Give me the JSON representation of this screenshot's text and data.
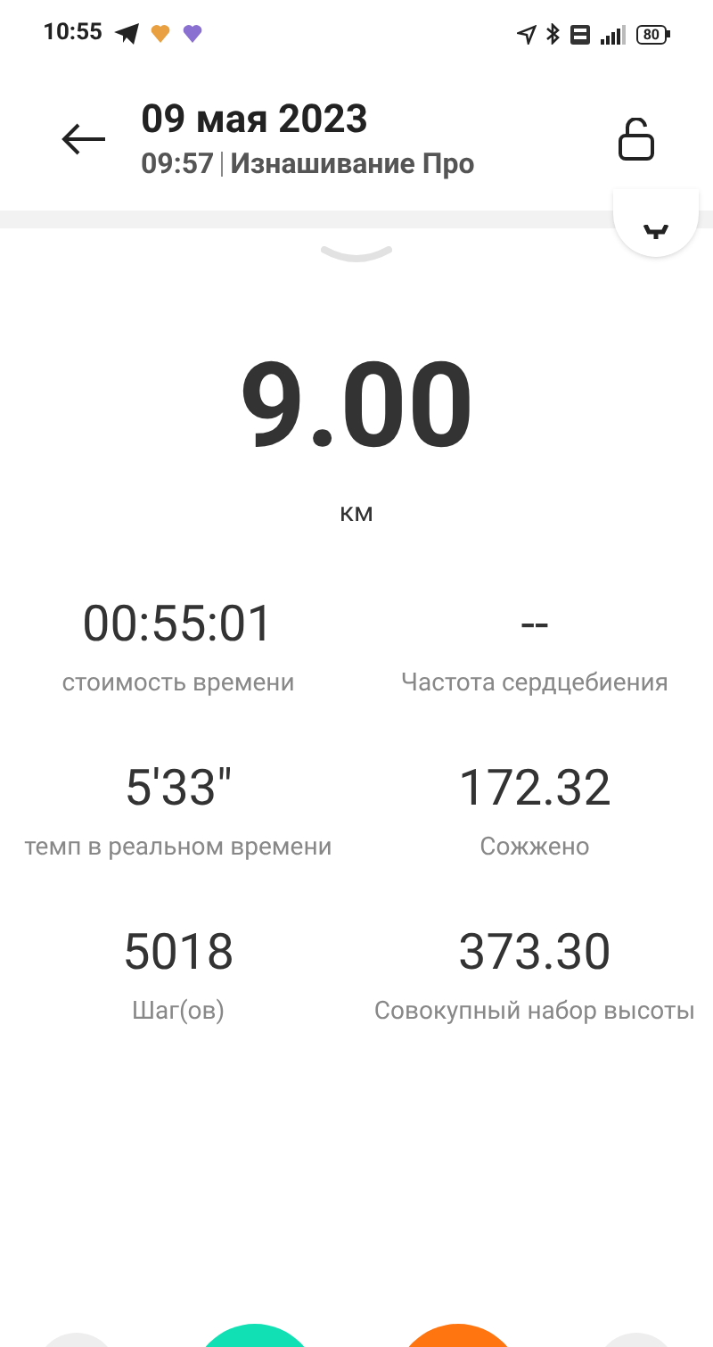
{
  "status_bar": {
    "time": "10:55",
    "battery": "80"
  },
  "header": {
    "title": "09 мая 2023",
    "time": "09:57",
    "device": "Изнашивание Про"
  },
  "distance": {
    "value": "9.00",
    "unit": "км"
  },
  "stats": [
    {
      "value": "00:55:01",
      "label": "стоимость времени"
    },
    {
      "value": "--",
      "label": "Частота сердцебиения"
    },
    {
      "value": "5'33\"",
      "label": "темп в реальном времени"
    },
    {
      "value": "172.32",
      "label": "Сожжено"
    },
    {
      "value": "5018",
      "label": "Шаг(ов)"
    },
    {
      "value": "373.30",
      "label": "Совокупный набор высоты"
    }
  ],
  "bottom_buttons": [
    {
      "color": "#eeeeee"
    },
    {
      "color": "#10e0b4"
    },
    {
      "color": "#ff7510"
    },
    {
      "color": "#eeeeee"
    }
  ]
}
